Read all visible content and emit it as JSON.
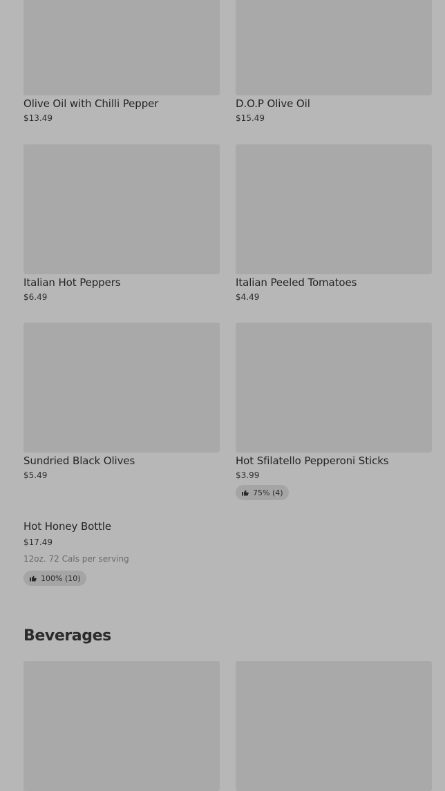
{
  "products": [
    {
      "name": "Olive Oil with Chilli Pepper",
      "price": "$13.49"
    },
    {
      "name": "D.O.P Olive Oil",
      "price": "$15.49"
    },
    {
      "name": "Italian Hot Peppers",
      "price": "$6.49"
    },
    {
      "name": "Italian Peeled Tomatoes",
      "price": "$4.49"
    },
    {
      "name": "Sundried Black Olives",
      "price": "$5.49"
    },
    {
      "name": "Hot Sfilatello Pepperoni Sticks",
      "price": "$3.99",
      "rating": "75% (4)"
    },
    {
      "name": "Hot Honey Bottle",
      "price": "$17.49",
      "description": "12oz. 72 Cals per serving",
      "rating": "100% (10)"
    }
  ],
  "sections": {
    "beverages_title": "Beverages"
  },
  "icons": {
    "rating_icon": "thumbs-up-icon"
  },
  "colors": {
    "background": "#b7b7b7",
    "image_placeholder": "#a9a9a9",
    "rating_pill": "#a5a5a5"
  }
}
